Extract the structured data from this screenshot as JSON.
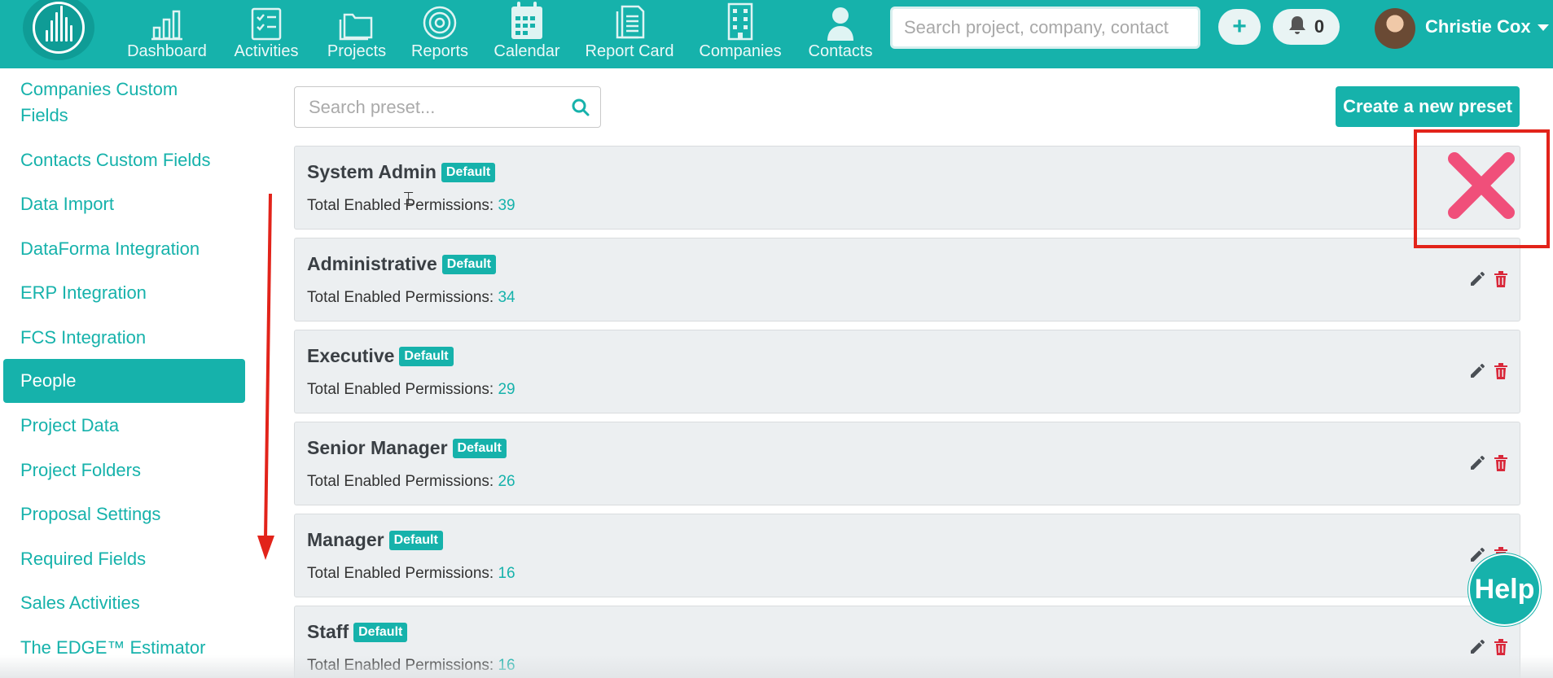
{
  "nav": {
    "items": [
      {
        "label": "Dashboard",
        "icon": "bar-chart-icon"
      },
      {
        "label": "Activities",
        "icon": "checklist-icon"
      },
      {
        "label": "Projects",
        "icon": "folders-icon"
      },
      {
        "label": "Reports",
        "icon": "target-icon"
      },
      {
        "label": "Calendar",
        "icon": "calendar-icon"
      },
      {
        "label": "Report Card",
        "icon": "documents-icon"
      },
      {
        "label": "Companies",
        "icon": "building-icon"
      },
      {
        "label": "Contacts",
        "icon": "person-icon"
      }
    ],
    "search_placeholder": "Search project, company, contact",
    "add_label": "+",
    "notification_count": "0",
    "user_name": "Christie Cox"
  },
  "sidebar": {
    "items": [
      {
        "label": "Companies Custom Fields"
      },
      {
        "label": "Contacts Custom Fields"
      },
      {
        "label": "Data Import"
      },
      {
        "label": "DataForma Integration"
      },
      {
        "label": "ERP Integration"
      },
      {
        "label": "FCS Integration"
      },
      {
        "label": "People",
        "active": true
      },
      {
        "label": "Project Data"
      },
      {
        "label": "Project Folders"
      },
      {
        "label": "Proposal Settings"
      },
      {
        "label": "Required Fields"
      },
      {
        "label": "Sales Activities"
      },
      {
        "label": "The EDGE™ Estimator"
      }
    ]
  },
  "main": {
    "preset_search_placeholder": "Search preset...",
    "create_button": "Create a new preset",
    "permissions_label": "Total Enabled Permissions:",
    "presets": [
      {
        "name": "System Admin",
        "badge": "Default",
        "count": "39"
      },
      {
        "name": "Administrative",
        "badge": "Default",
        "count": "34"
      },
      {
        "name": "Executive",
        "badge": "Default",
        "count": "29"
      },
      {
        "name": "Senior Manager",
        "badge": "Default",
        "count": "26"
      },
      {
        "name": "Manager",
        "badge": "Default",
        "count": "16"
      },
      {
        "name": "Staff",
        "badge": "Default",
        "count": "16"
      }
    ]
  },
  "help_label": "Help",
  "colors": {
    "teal": "#16b2ab",
    "card_bg": "#eceff1",
    "delete_red": "#d9283a",
    "annotation_red": "#e2231a",
    "x_pink": "#f04f7a"
  }
}
